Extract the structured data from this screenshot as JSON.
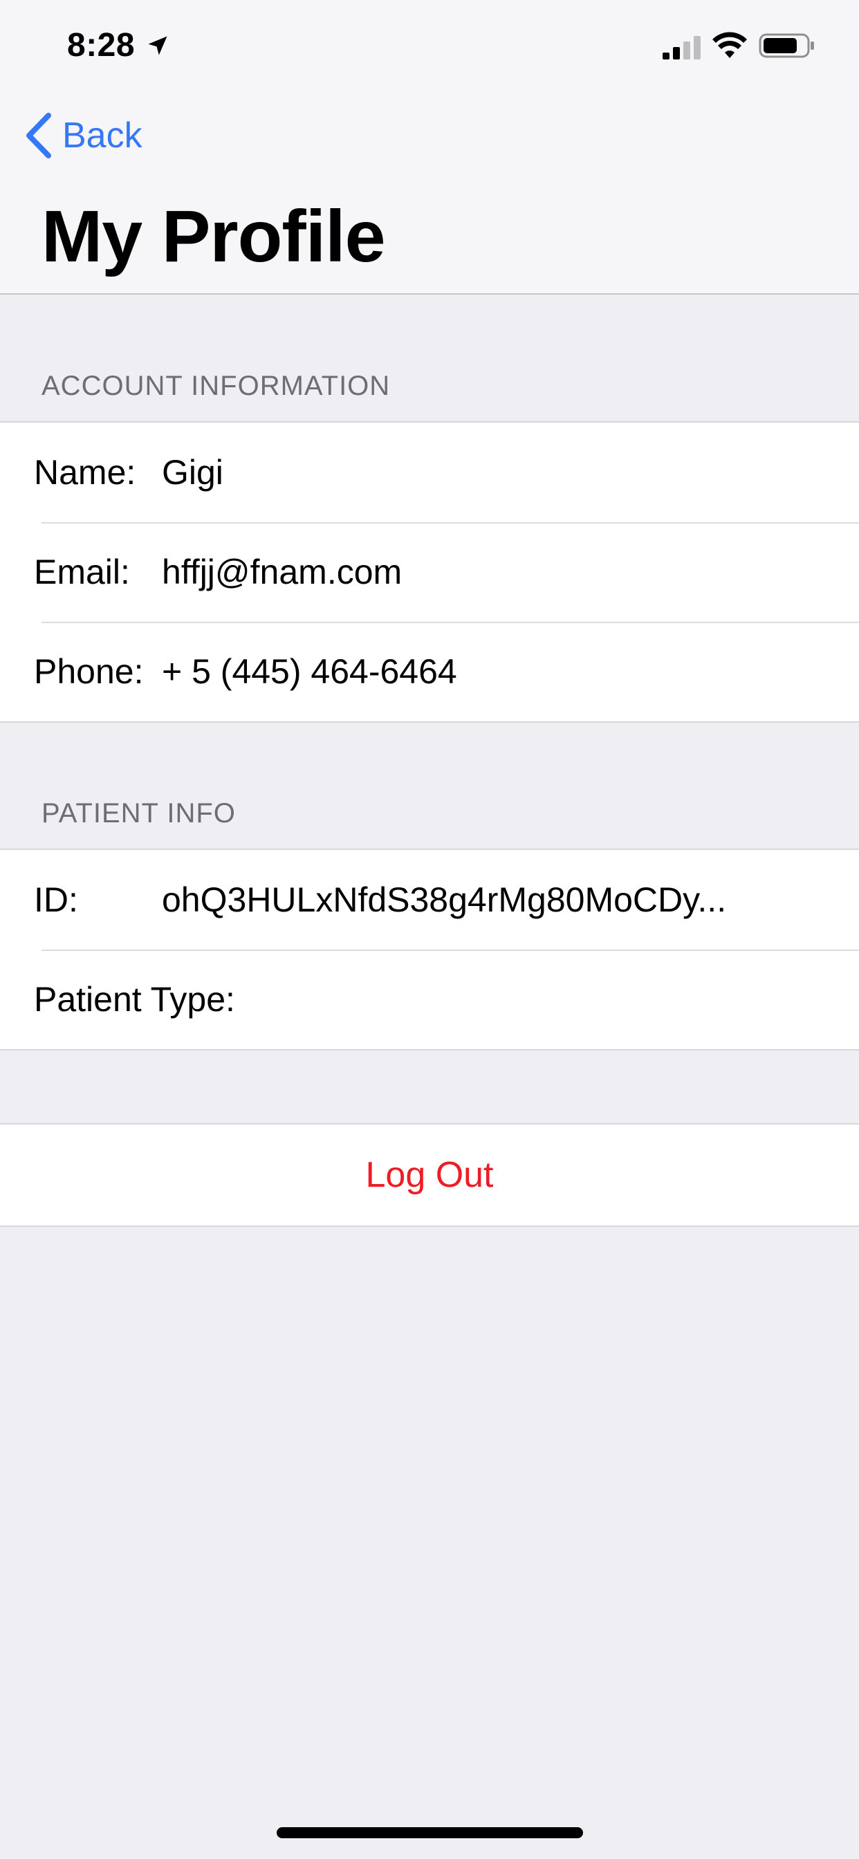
{
  "status_bar": {
    "time": "8:28",
    "icons": [
      "location-arrow-icon",
      "cellular-signal-icon",
      "wifi-icon",
      "battery-icon"
    ]
  },
  "nav": {
    "back_label": "Back",
    "title": "My Profile"
  },
  "account": {
    "header": "ACCOUNT INFORMATION",
    "rows": [
      {
        "label": "Name:",
        "value": "Gigi"
      },
      {
        "label": "Email:",
        "value": "hffjj@fnam.com"
      },
      {
        "label": "Phone:",
        "value": "+ 5 (445) 464-6464"
      }
    ]
  },
  "patient": {
    "header": "PATIENT INFO",
    "rows": [
      {
        "label": "ID:",
        "value": "ohQ3HULxNfdS38g4rMg80MoCDy..."
      },
      {
        "label": "Patient Type:",
        "value": ""
      }
    ]
  },
  "actions": {
    "logout_label": "Log Out"
  },
  "colors": {
    "accent": "#3478F6",
    "destructive": "#EE1C24",
    "background": "#EEEEF3"
  }
}
